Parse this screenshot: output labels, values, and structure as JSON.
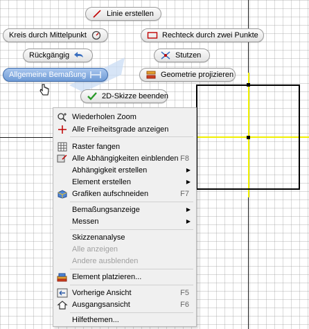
{
  "marking_menu": {
    "line": "Linie erstellen",
    "circle": "Kreis durch Mittelpunkt",
    "rectangle": "Rechteck durch zwei Punkte",
    "undo": "Rückgängig",
    "trim": "Stutzen",
    "dimension": "Allgemeine Bemaßung",
    "project": "Geometrie projizieren",
    "finish_sketch": "2D-Skizze beenden"
  },
  "context_menu": {
    "items": [
      {
        "label": "Wiederholen Zoom",
        "shortcut": "",
        "arrow": ""
      },
      {
        "label": "Alle Freiheitsgrade anzeigen",
        "shortcut": "",
        "arrow": ""
      },
      {
        "label": "Raster fangen",
        "shortcut": "",
        "arrow": ""
      },
      {
        "label": "Alle Abhängigkeiten einblenden",
        "shortcut": "F8",
        "arrow": ""
      },
      {
        "label": "Abhängigkeit erstellen",
        "shortcut": "",
        "arrow": "▶"
      },
      {
        "label": "Element erstellen",
        "shortcut": "",
        "arrow": "▶"
      },
      {
        "label": "Grafiken aufschneiden",
        "shortcut": "F7",
        "arrow": ""
      },
      {
        "label": "Bemaßungsanzeige",
        "shortcut": "",
        "arrow": "▶"
      },
      {
        "label": "Messen",
        "shortcut": "",
        "arrow": "▶"
      },
      {
        "label": "Skizzenanalyse",
        "shortcut": "",
        "arrow": ""
      },
      {
        "label": "Alle anzeigen",
        "shortcut": "",
        "arrow": ""
      },
      {
        "label": "Andere ausblenden",
        "shortcut": "",
        "arrow": ""
      },
      {
        "label": "Element platzieren...",
        "shortcut": "",
        "arrow": ""
      },
      {
        "label": "Vorherige Ansicht",
        "shortcut": "F5",
        "arrow": ""
      },
      {
        "label": "Ausgangsansicht",
        "shortcut": "F6",
        "arrow": ""
      },
      {
        "label": "Hilfethemen...",
        "shortcut": "",
        "arrow": ""
      }
    ]
  },
  "colors": {
    "sketch_highlight": "#f0f000",
    "active_pill": "#6f9bd6",
    "menu_bg": "#f0f0f0"
  }
}
